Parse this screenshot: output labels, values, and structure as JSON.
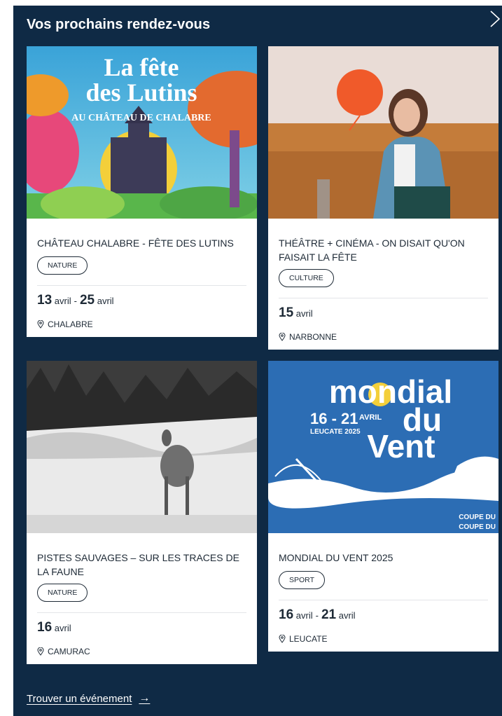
{
  "panel": {
    "title": "Vos prochains rendez-vous",
    "close_icon": "close-icon",
    "footer_link": "Trouver un événement"
  },
  "events": [
    {
      "title": "Château Chalabre - Fête des Lutins",
      "tag": "Nature",
      "date_start_day": "13",
      "date_start_month": "avril",
      "date_end_day": "25",
      "date_end_month": "avril",
      "location": "CHALABRE",
      "poster": {
        "line1": "La fête",
        "line2": "des Lutins",
        "line3": "AU CHÂTEAU DE CHALABRE"
      }
    },
    {
      "title": "Théâtre + Cinéma - On disait qu'on faisait la fête",
      "tag": "Culture",
      "date_start_day": "15",
      "date_start_month": "avril",
      "location": "NARBONNE"
    },
    {
      "title": "Pistes sauvages – Sur les traces de la faune",
      "tag": "Nature",
      "date_start_day": "16",
      "date_start_month": "avril",
      "location": "CAMURAC"
    },
    {
      "title": "Mondial du Vent 2025",
      "tag": "Sport",
      "date_start_day": "16",
      "date_start_month": "avril",
      "date_end_day": "21",
      "date_end_month": "avril",
      "location": "LEUCATE",
      "poster": {
        "brand1": "mondial",
        "brand2": "du",
        "brand3": "Vent",
        "dates": "16 - 21",
        "month": "AVRIL",
        "place": "LEUCATE 2025",
        "corner1": "COUPE DU",
        "corner2": "COUPE DU"
      }
    }
  ],
  "colors": {
    "panel_bg": "#0f2a45",
    "card_bg": "#ffffff",
    "text": "#1e2a36",
    "mondial_blue": "#2c6db4"
  }
}
